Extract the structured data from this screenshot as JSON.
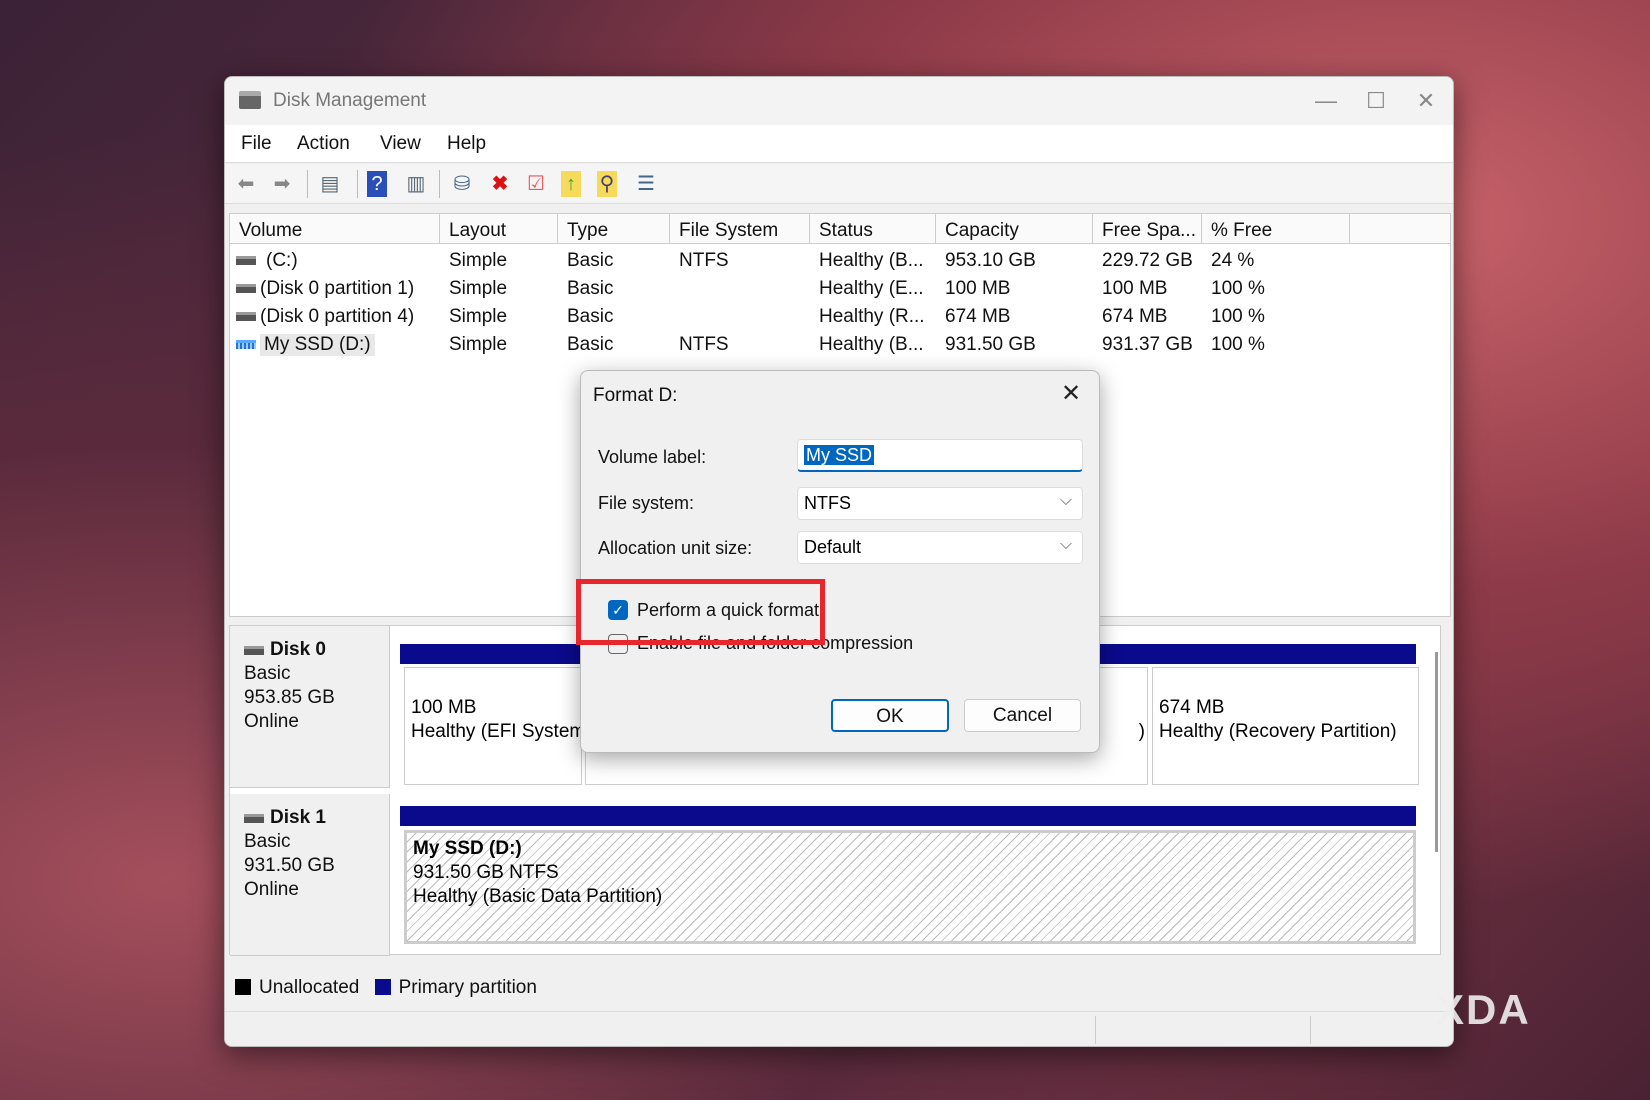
{
  "window": {
    "title": "Disk Management",
    "controls": [
      "minimize",
      "maximize",
      "close"
    ]
  },
  "menu": [
    "File",
    "Action",
    "View",
    "Help"
  ],
  "toolbar": [
    "back-icon",
    "forward-icon",
    "console-tree-icon",
    "help-icon",
    "action-pane-icon",
    "connect-disk-icon",
    "delete-icon",
    "properties-icon",
    "up-folder-icon",
    "search-folder-icon",
    "settings-list-icon"
  ],
  "columns": [
    "Volume",
    "Layout",
    "Type",
    "File System",
    "Status",
    "Capacity",
    "Free Spa...",
    "% Free"
  ],
  "rows": [
    {
      "volume": "(C:)",
      "layout": "Simple",
      "type": "Basic",
      "fs": "NTFS",
      "status": "Healthy (B...",
      "capacity": "953.10 GB",
      "free": "229.72 GB",
      "pct": "24 %"
    },
    {
      "volume": "(Disk 0 partition 1)",
      "layout": "Simple",
      "type": "Basic",
      "fs": "",
      "status": "Healthy (E...",
      "capacity": "100 MB",
      "free": "100 MB",
      "pct": "100 %"
    },
    {
      "volume": "(Disk 0 partition 4)",
      "layout": "Simple",
      "type": "Basic",
      "fs": "",
      "status": "Healthy (R...",
      "capacity": "674 MB",
      "free": "674 MB",
      "pct": "100 %"
    },
    {
      "volume": "My SSD (D:)",
      "layout": "Simple",
      "type": "Basic",
      "fs": "NTFS",
      "status": "Healthy (B...",
      "capacity": "931.50 GB",
      "free": "931.37 GB",
      "pct": "100 %"
    }
  ],
  "disks": [
    {
      "name": "Disk 0",
      "type": "Basic",
      "size": "953.85 GB",
      "state": "Online",
      "partitions": [
        {
          "size": "100 MB",
          "status": "Healthy (EFI System Partition)"
        },
        {
          "tail": ")"
        },
        {
          "size": "674 MB",
          "status": "Healthy (Recovery Partition)"
        }
      ]
    },
    {
      "name": "Disk 1",
      "type": "Basic",
      "size": "931.50 GB",
      "state": "Online",
      "partitions": [
        {
          "name": "My SSD  (D:)",
          "size": "931.50 GB NTFS",
          "status": "Healthy (Basic Data Partition)"
        }
      ]
    }
  ],
  "legend": [
    {
      "label": "Unallocated",
      "color": "#000000"
    },
    {
      "label": "Primary partition",
      "color": "#0a0a8c"
    }
  ],
  "dialog": {
    "title": "Format D:",
    "volume_label_label": "Volume label:",
    "volume_label_value": "My SSD",
    "file_system_label": "File system:",
    "file_system_value": "NTFS",
    "alloc_label": "Allocation unit size:",
    "alloc_value": "Default",
    "quick_format": {
      "label": "Perform a quick format",
      "checked": true
    },
    "compression": {
      "label": "Enable file and folder compression",
      "checked": false
    },
    "ok": "OK",
    "cancel": "Cancel",
    "accent": "#0067c0",
    "highlight_color": "#e8262b"
  },
  "watermark": "XDA"
}
